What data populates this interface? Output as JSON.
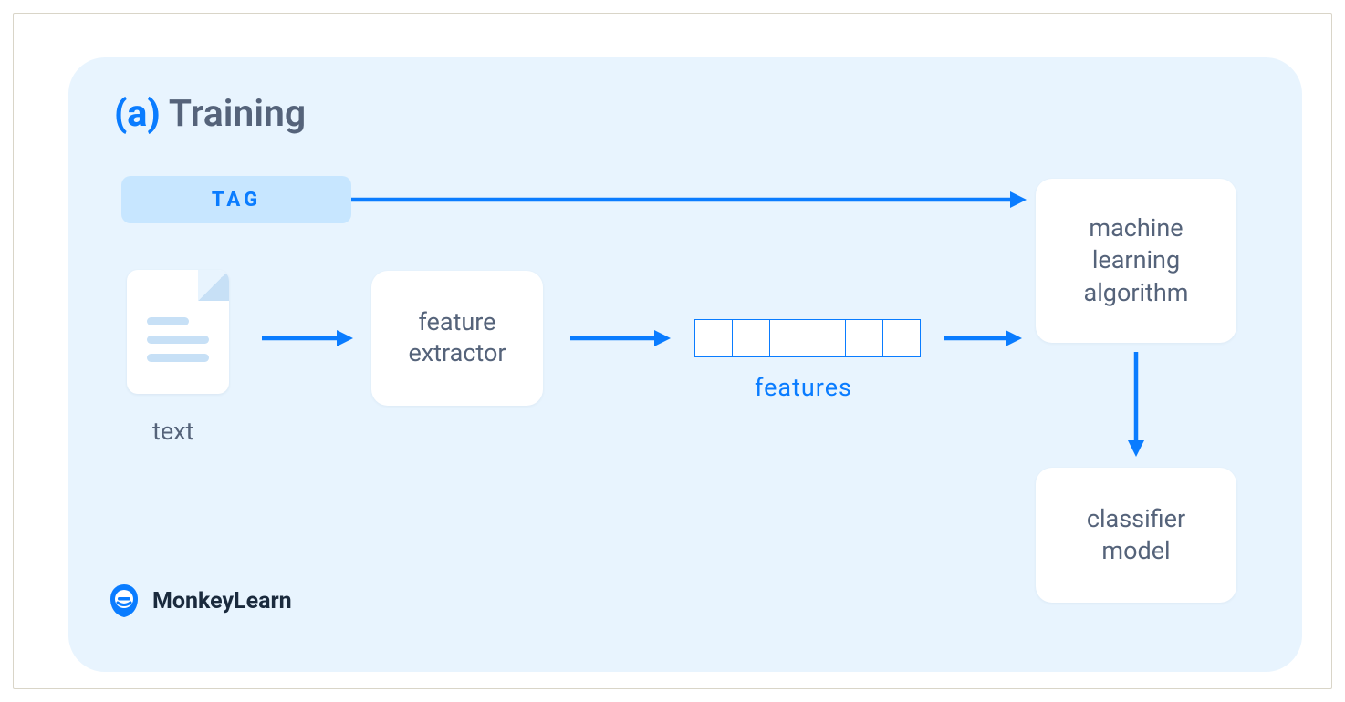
{
  "heading": {
    "prefix": "(a)",
    "title": "Training"
  },
  "tag": {
    "label": "TAG"
  },
  "input": {
    "text_label": "text"
  },
  "feature_extractor": {
    "label": "feature\nextractor"
  },
  "features": {
    "label": "features",
    "cell_count": 6
  },
  "ml_algorithm": {
    "label": "machine\nlearning\nalgorithm"
  },
  "classifier": {
    "label": "classifier\nmodel"
  },
  "brand": {
    "name": "MonkeyLearn"
  },
  "colors": {
    "accent": "#0a7cff",
    "panel_bg": "#e8f4fe",
    "tag_bg": "#c7e6ff",
    "text_muted": "#55637a"
  }
}
